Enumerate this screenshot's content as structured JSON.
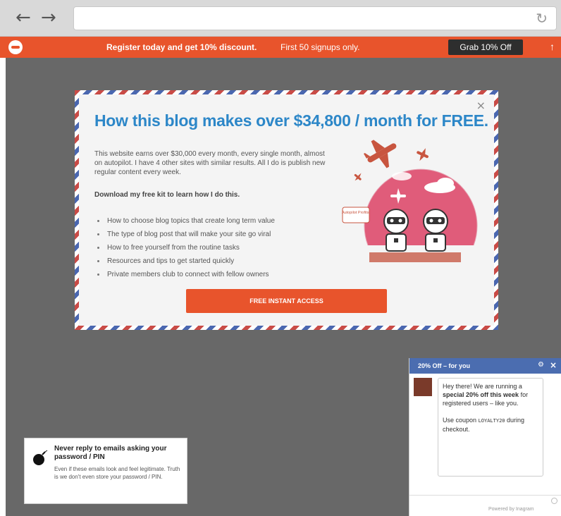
{
  "browser": {
    "back_icon": "arrow-left-icon",
    "forward_icon": "arrow-right-icon",
    "address_value": "",
    "reload_icon": "reload-icon"
  },
  "hello_bar": {
    "bg_color": "#e8542c",
    "message": "Register today and get 10% discount.",
    "sub_message": "First 50 signups only.",
    "cta_label": "Grab 10% Off"
  },
  "modal": {
    "title": "How this blog makes over $34,800 / month for FREE.",
    "description": "This website earns over $30,000 every month, every single month, almost on autopilot. I have 4 other sites with similar results. All I do is publish new regular content every week.",
    "lead": "Download my free kit to learn how I do this.",
    "benefits": [
      "How to choose blog topics that create long term value",
      "The type of blog post that will make your site go viral",
      "How to free yourself from the routine tasks",
      "Resources and tips to get started quickly",
      "Private members club to connect with fellow owners"
    ],
    "cta_label": "FREE INSTANT ACCESS",
    "speech_bubble": "Autopilot Profits!",
    "accent_color": "#2d87c8",
    "cta_color": "#e8542c"
  },
  "notice": {
    "title": "Never reply to emails asking your password / PIN",
    "body": "Even if these emails look and feel legitimate. Truth is we don't even store your password / PIN."
  },
  "chat": {
    "header_title": "20% Off – for you",
    "header_color": "#4b6db0",
    "msg_intro": "Hey there! We are running a",
    "msg_bold": "special 20% off this week",
    "msg_end": "for registered users – like you.",
    "coupon_prefix": "Use coupon",
    "coupon_code": "LOYALTY20",
    "coupon_suffix": "during checkout.",
    "powered": "Powered by Inagram"
  }
}
